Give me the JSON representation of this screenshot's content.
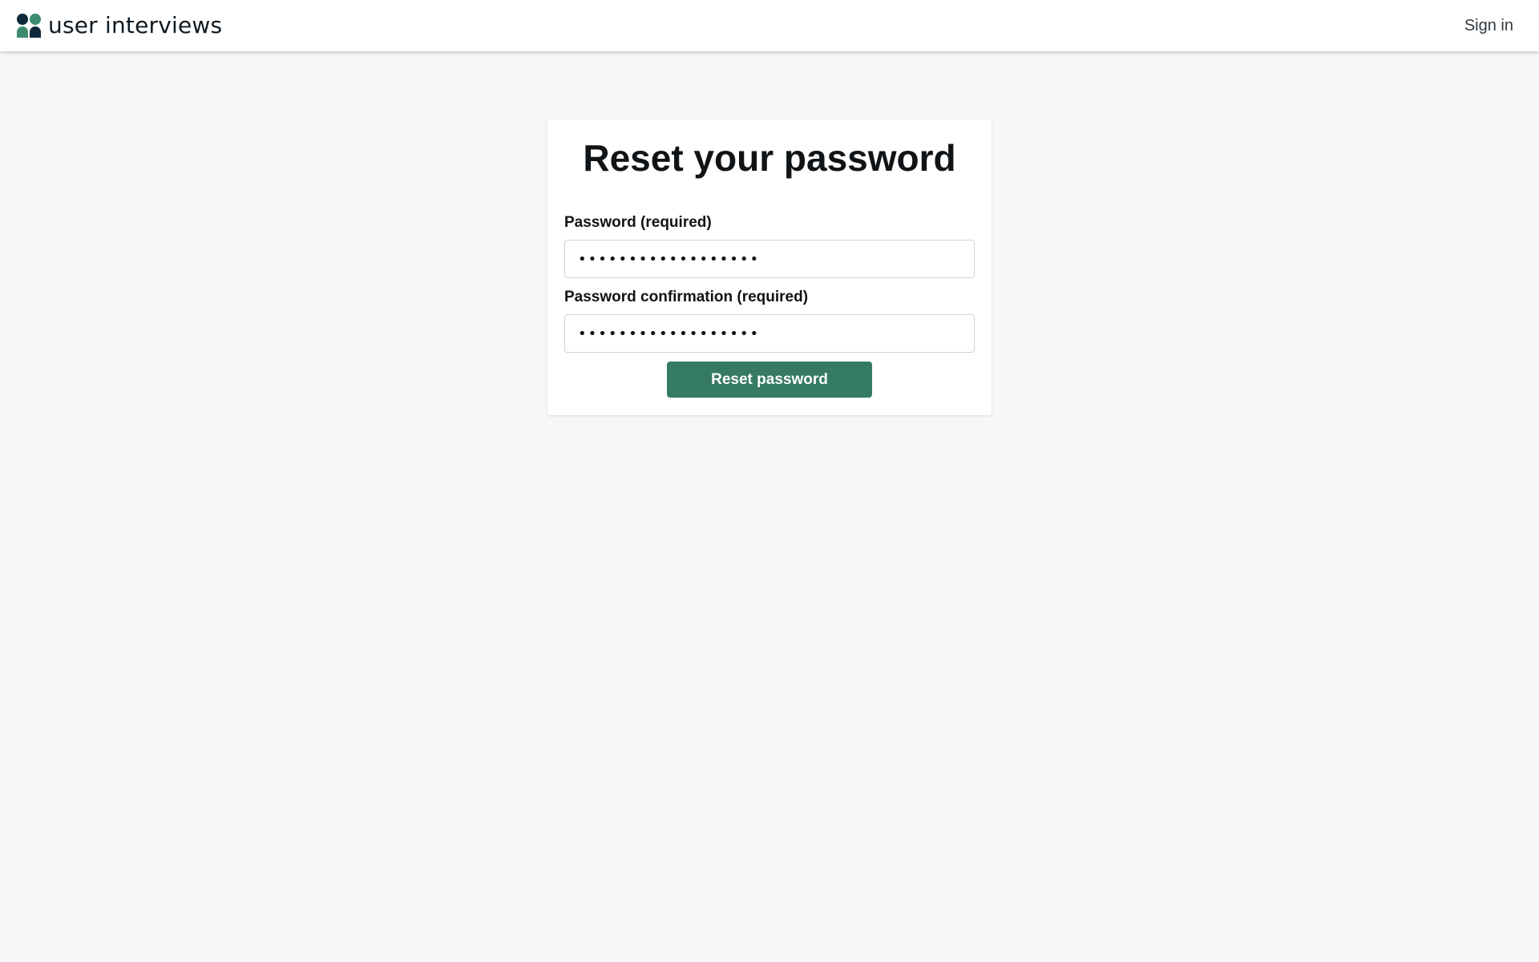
{
  "header": {
    "brand_name": "user interviews",
    "signin_label": "Sign in"
  },
  "form": {
    "title": "Reset your password",
    "password_label": "Password (required)",
    "password_value": "••••••••••••••••••",
    "confirmation_label": "Password confirmation (required)",
    "confirmation_value": "••••••••••••••••••",
    "submit_label": "Reset password"
  },
  "colors": {
    "accent": "#357a64",
    "logo_dark": "#0f2a3a",
    "logo_green": "#3d8c6f",
    "page_background": "#f7f7f7"
  }
}
